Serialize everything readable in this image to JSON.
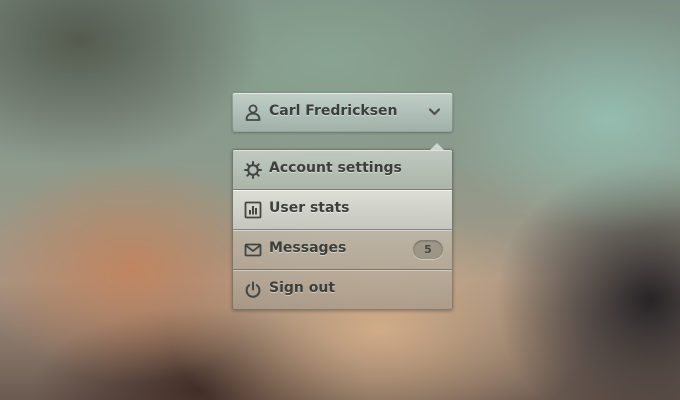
{
  "user_menu": {
    "trigger": {
      "user_name": "Carl Fredricksen",
      "user_icon": "user-icon",
      "chevron_icon": "chevron-down-icon"
    },
    "items": [
      {
        "label": "Account settings",
        "icon": "gear-icon"
      },
      {
        "label": "User stats",
        "icon": "bar-chart-icon",
        "highlighted": true
      },
      {
        "label": "Messages",
        "icon": "envelope-icon",
        "badge": "5"
      },
      {
        "label": "Sign out",
        "icon": "power-icon"
      }
    ]
  },
  "colors": {
    "text": "#3b403d",
    "badge_text": "#4a4a44"
  }
}
